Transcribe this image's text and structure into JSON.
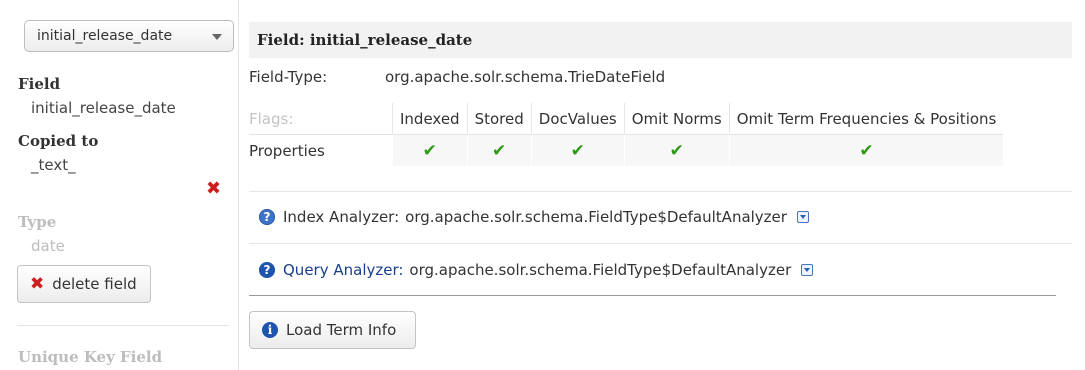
{
  "sidebar": {
    "field_select": {
      "selected": "initial_release_date"
    },
    "field_label": "Field",
    "field_value": "initial_release_date",
    "copied_to_label": "Copied to",
    "copied_to_value": "_text_",
    "remove_icon": "close-icon",
    "type_label": "Type",
    "type_value": "date",
    "delete_button_label": "delete field",
    "unique_key_label": "Unique Key Field"
  },
  "main": {
    "title": "Field: initial_release_date",
    "field_type_label": "Field-Type:",
    "field_type_value": "org.apache.solr.schema.TrieDateField",
    "flags": {
      "row_label": "Flags:",
      "columns": [
        "Indexed",
        "Stored",
        "DocValues",
        "Omit Norms",
        "Omit Term Frequencies & Positions"
      ],
      "properties_label": "Properties",
      "properties": [
        true,
        true,
        true,
        true,
        true
      ]
    },
    "index_analyzer": {
      "label": "Index Analyzer:",
      "value": "org.apache.solr.schema.FieldType$DefaultAnalyzer"
    },
    "query_analyzer": {
      "label": "Query Analyzer:",
      "value": "org.apache.solr.schema.FieldType$DefaultAnalyzer"
    },
    "load_term_info_label": "Load Term Info"
  },
  "icons": {
    "check": "check-icon",
    "help": "help-icon",
    "info": "info-icon",
    "toggle": "chevron-down-icon"
  },
  "colors": {
    "check": "#2e9a16",
    "remove": "#cc1f1f",
    "help": "#3d74c9",
    "header_bg": "#f2f2f2"
  }
}
